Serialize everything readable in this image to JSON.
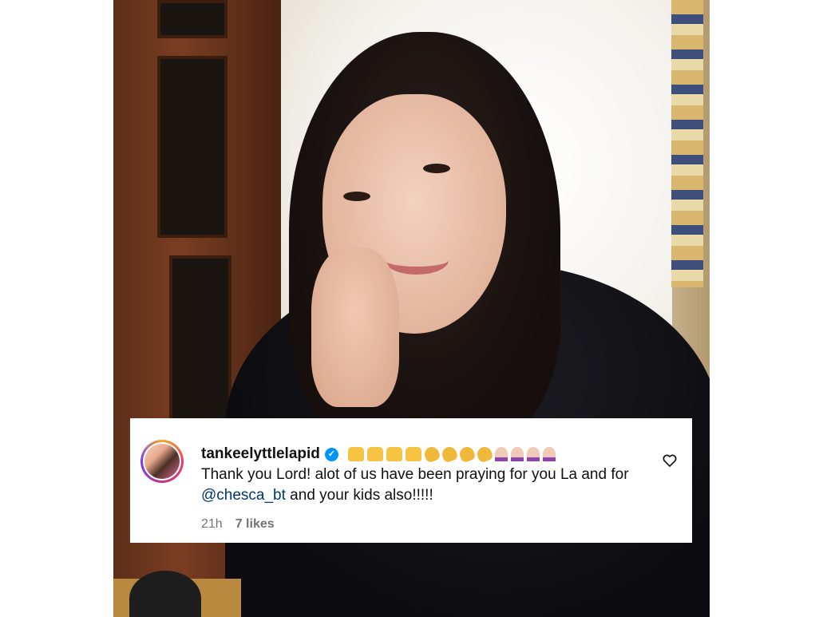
{
  "comment": {
    "username": "tankeelyttlelapid",
    "verified": true,
    "reaction_emojis": [
      "raising-hands",
      "raising-hands",
      "raising-hands",
      "raising-hands",
      "clapping-hands",
      "clapping-hands",
      "clapping-hands",
      "clapping-hands",
      "folded-hands",
      "folded-hands",
      "folded-hands",
      "folded-hands"
    ],
    "text_before_mention": "Thank you Lord! alot of us have been praying for you La and for ",
    "mention": "@chesca_bt",
    "text_after_mention": " and your kids also!!!!!",
    "time_ago": "21h",
    "likes": "7 likes"
  },
  "colors": {
    "verified_badge": "#0095f6",
    "mention_link": "#00376b",
    "meta_text": "#737373"
  }
}
